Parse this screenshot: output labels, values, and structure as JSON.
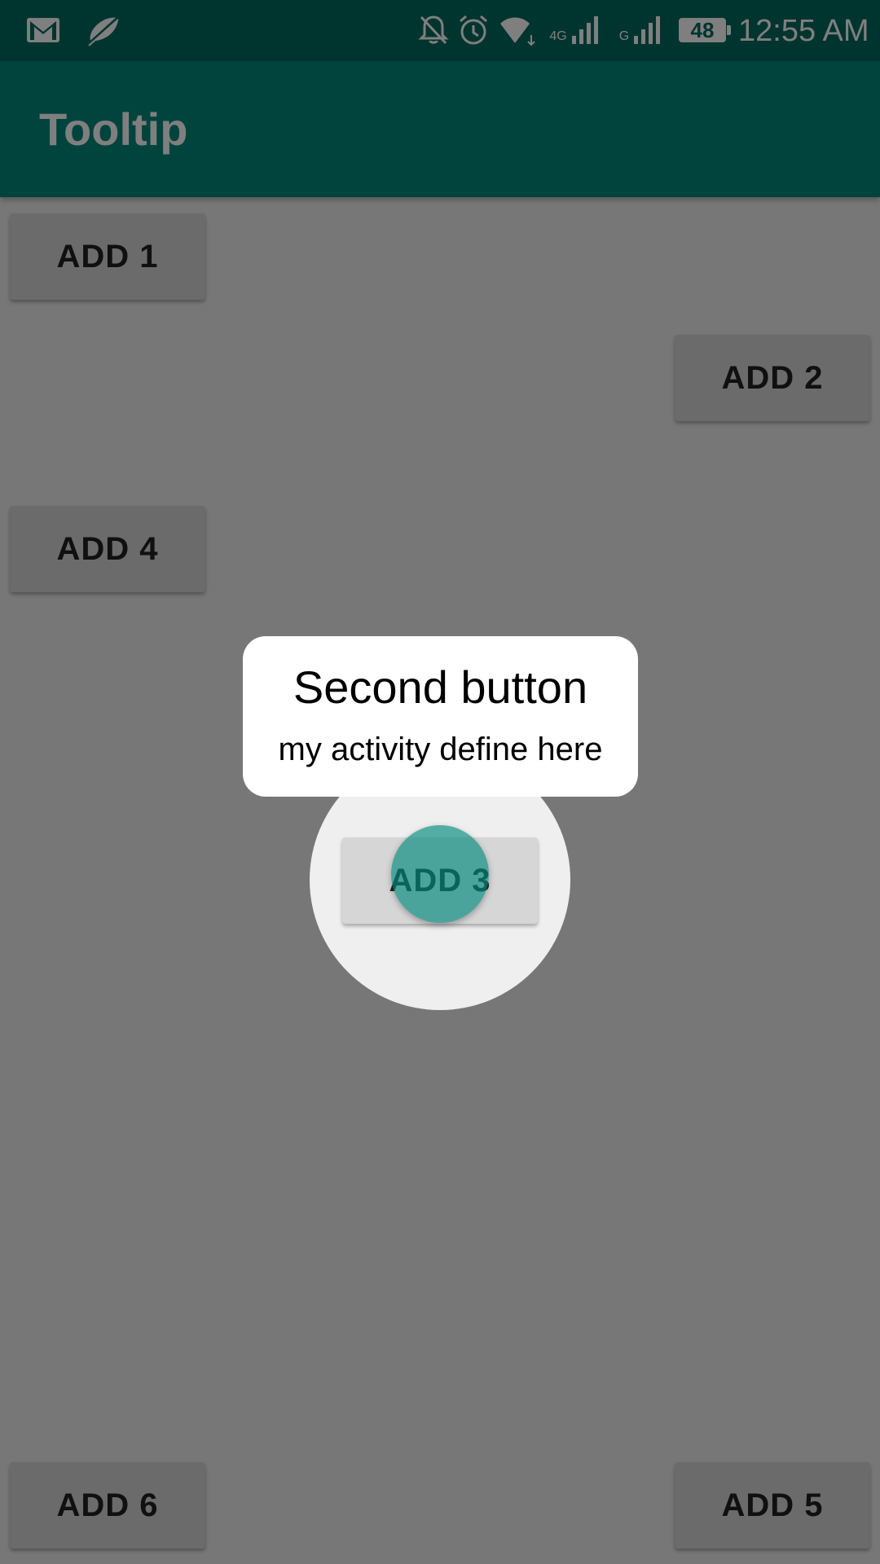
{
  "status_bar": {
    "time": "12:55 AM",
    "battery": "48",
    "network_4g": "4G",
    "network_g": "G",
    "icons": [
      "gmail-icon",
      "do-not-disturb-icon",
      "notifications-off-icon",
      "alarm-icon",
      "wifi-icon",
      "signal-icon",
      "signal-icon",
      "battery-icon"
    ]
  },
  "app_bar": {
    "title": "Tooltip"
  },
  "buttons": {
    "add1": "ADD 1",
    "add2": "ADD 2",
    "add3": "ADD  3",
    "add4": "ADD 4",
    "add5": "ADD 5",
    "add6": "ADD 6"
  },
  "tooltip": {
    "title": "Second button",
    "description": "my activity define here"
  },
  "colors": {
    "status_bar": "#00695c",
    "primary": "#00897b",
    "accent_pulse": "#4db6ac"
  }
}
